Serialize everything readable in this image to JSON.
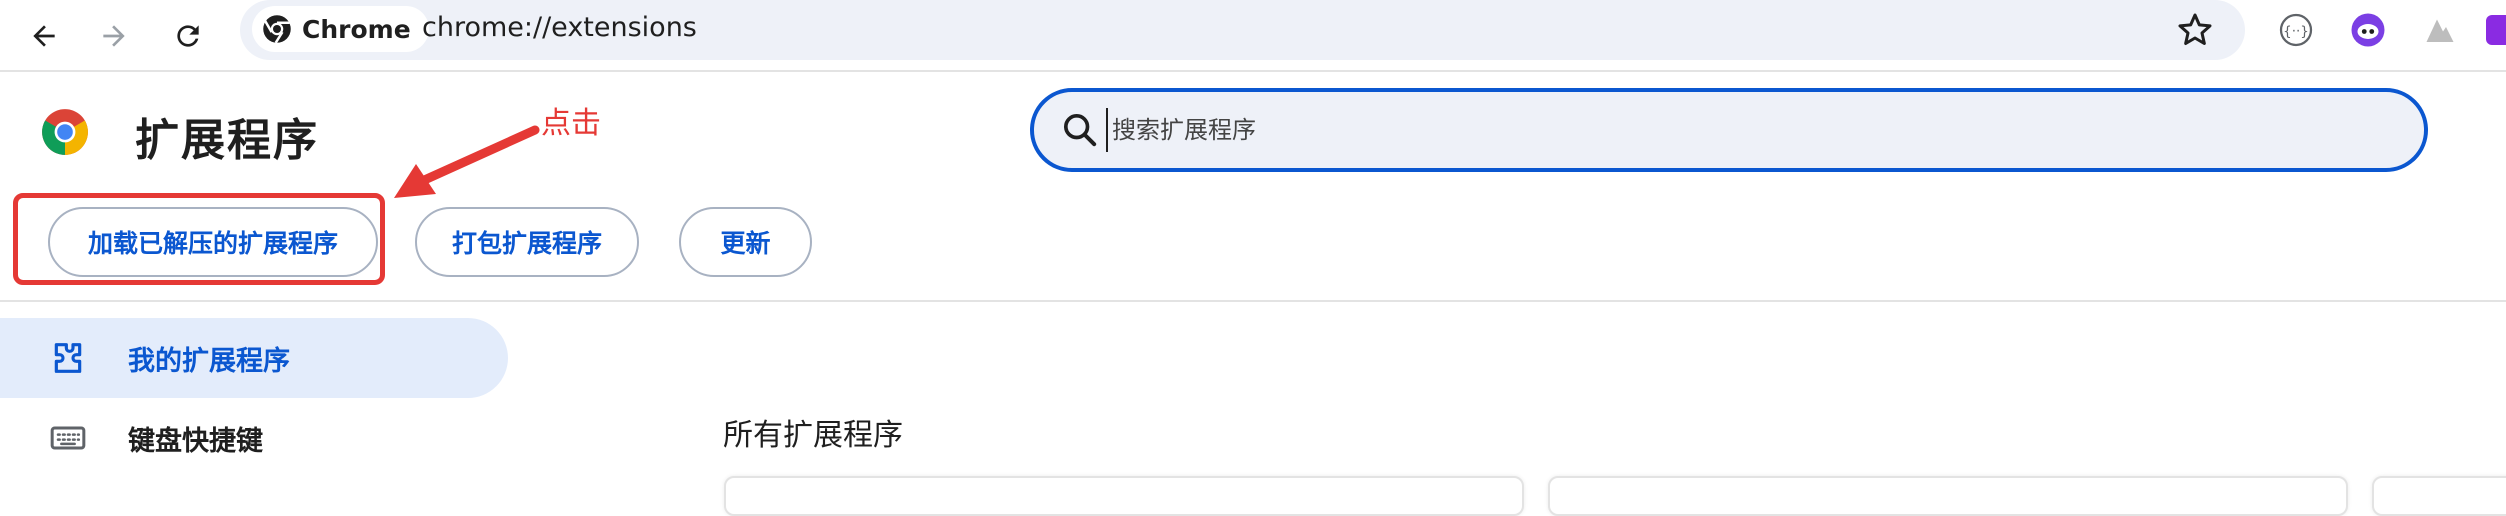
{
  "browser": {
    "chip_label": "Chrome",
    "url": "chrome://extensions"
  },
  "page": {
    "title": "扩展程序",
    "search_placeholder": "搜索扩展程序"
  },
  "annotation": {
    "label": "点击",
    "color": "#e53935"
  },
  "actions": [
    {
      "label": "加载已解压的扩展程序"
    },
    {
      "label": "打包扩展程序"
    },
    {
      "label": "更新"
    }
  ],
  "sidebar": {
    "items": [
      {
        "label": "我的扩展程序",
        "icon": "extension-puzzle-icon",
        "active": true
      },
      {
        "label": "键盘快捷键",
        "icon": "keyboard-icon",
        "active": false
      }
    ]
  },
  "main": {
    "section_title": "所有扩展程序"
  },
  "colors": {
    "accent": "#0b57d0",
    "sidebar_active": "#e3ecfb",
    "annotation": "#e53935"
  }
}
